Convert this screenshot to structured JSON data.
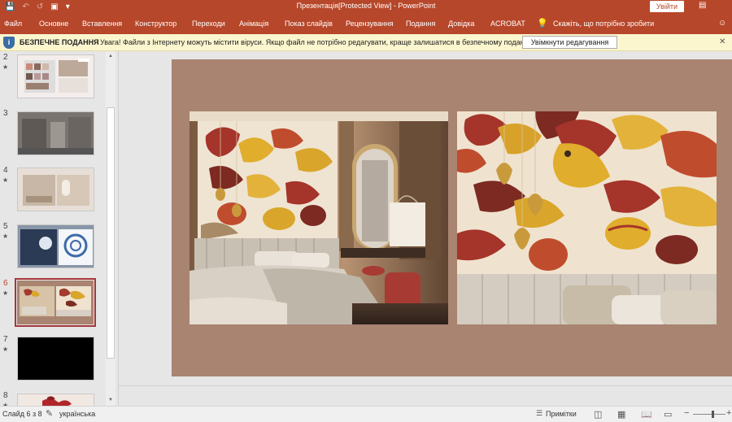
{
  "titlebar": {
    "title": "Презентація[Protected View]  -  PowerPoint",
    "login_label": "Увійти",
    "icons": [
      "save-icon",
      "undo-icon",
      "redo-icon",
      "start-from-beginning-icon",
      "customize-qat-icon",
      "ribbon-display-icon"
    ]
  },
  "ribbon": {
    "tabs": [
      "Файл",
      "Основне",
      "Вставлення",
      "Конструктор",
      "Переходи",
      "Анімація",
      "Показ слайдів",
      "Рецензування",
      "Подання",
      "Довідка",
      "ACROBAT"
    ],
    "tell_me": "Скажіть, що потрібно зробити"
  },
  "protected_view": {
    "title": "БЕЗПЕЧНЕ ПОДАННЯ",
    "message": "Увага! Файли з Інтернету можуть містити віруси. Якщо файл не потрібно редагувати, краще залишатися в безпечному поданні.",
    "enable_button": "Увімкнути редагування"
  },
  "slides": [
    {
      "number": "2",
      "star": "★"
    },
    {
      "number": "3",
      "star": ""
    },
    {
      "number": "4",
      "star": "★"
    },
    {
      "number": "5",
      "star": "★"
    },
    {
      "number": "6",
      "star": "★",
      "selected": true
    },
    {
      "number": "7",
      "star": "★"
    },
    {
      "number": "8",
      "star": "★"
    }
  ],
  "status": {
    "slide_info": "Слайд 6 з 8",
    "language": "українська",
    "notes_label": "Примітки"
  },
  "colors": {
    "accent": "#b7472a",
    "slide_background": "#a88471",
    "protected_bar": "#fcf6cf",
    "selected_thumbnail_border": "#a4373a"
  }
}
